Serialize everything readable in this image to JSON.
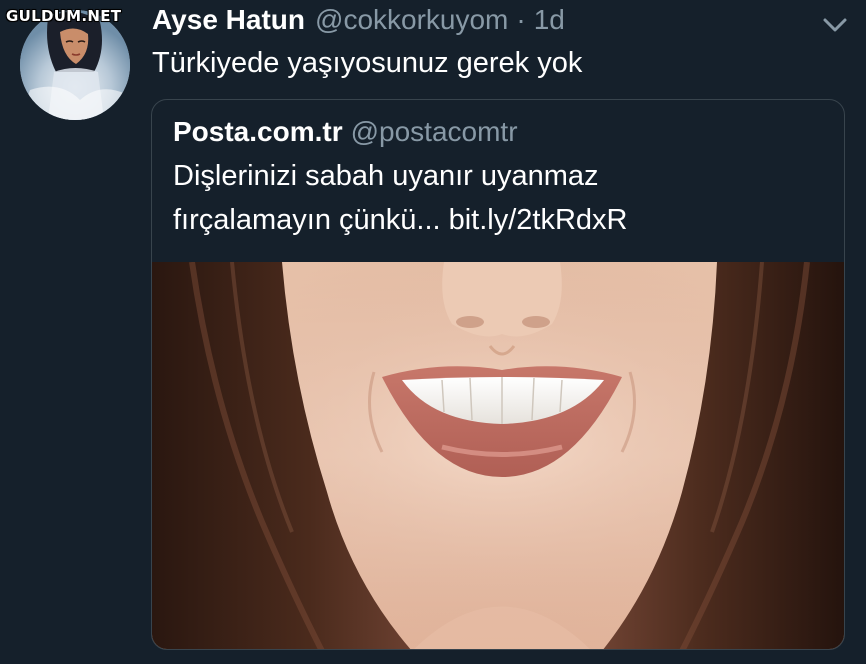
{
  "watermark": "GULDUM.NET",
  "tweet": {
    "author_name": "Ayse Hatun",
    "author_handle": "@cokkorkuyom",
    "separator": "·",
    "timestamp": "1d",
    "text": "Türkiyede yaşıyosunuz gerek yok"
  },
  "quoted_tweet": {
    "author_name": "Posta.com.tr",
    "author_handle": "@postacomtr",
    "text_line1": "Dişlerinizi sabah uyanır uyanmaz",
    "text_line2": "fırçalamayın çünkü... bit.ly/2tkRdxR"
  },
  "icons": {
    "menu": "chevron-down-icon",
    "avatar": "user-avatar"
  },
  "colors": {
    "background": "#15202b",
    "text_primary": "#ffffff",
    "text_secondary": "#8899a6",
    "border": "#38444d"
  }
}
